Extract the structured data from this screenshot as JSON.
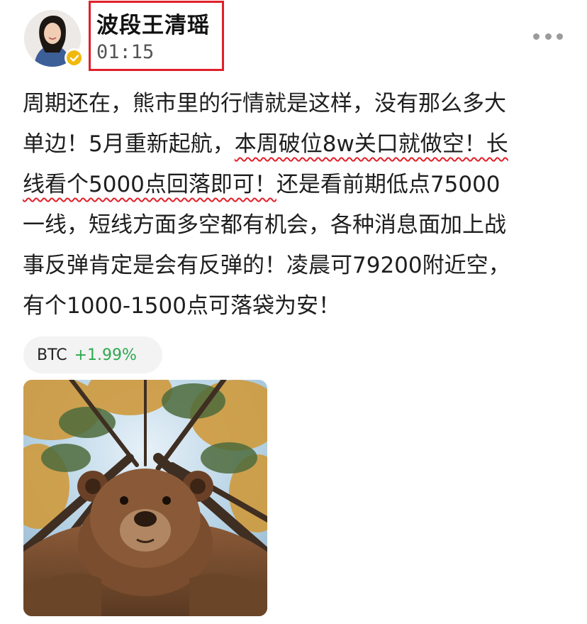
{
  "author": {
    "name": "波段王清瑶",
    "time": "01:15",
    "avatar_icon": "user-avatar-photo",
    "verified_icon": "verified-check-icon"
  },
  "post": {
    "lines": [
      {
        "pre": "周期还在，熊市里的行情就是这样，没有那么多大",
        "mark": "",
        "post": ""
      },
      {
        "pre": "单边！5月重新起航，",
        "mark": "本周破位8w关口就做空！长",
        "post": ""
      },
      {
        "pre": "",
        "mark": "线看个5000点回落即可！",
        "post": "还是看前期低点75000"
      },
      {
        "pre": "一线，短线方面多空都有机会，各种消息面加上战",
        "mark": "",
        "post": ""
      },
      {
        "pre": "事反弹肯定是会有反弹的！凌晨可79200附近空，",
        "mark": "",
        "post": ""
      },
      {
        "pre": "有个1000-1500点可落袋为安！",
        "mark": "",
        "post": ""
      }
    ]
  },
  "ticker": {
    "symbol": "BTC",
    "change": "+1.99%",
    "change_color": "#2ea84f"
  },
  "image": {
    "icon": "bear-selfie-forest-photo"
  },
  "colors": {
    "highlight": "#e0202a",
    "badge": "#f0b90b"
  }
}
